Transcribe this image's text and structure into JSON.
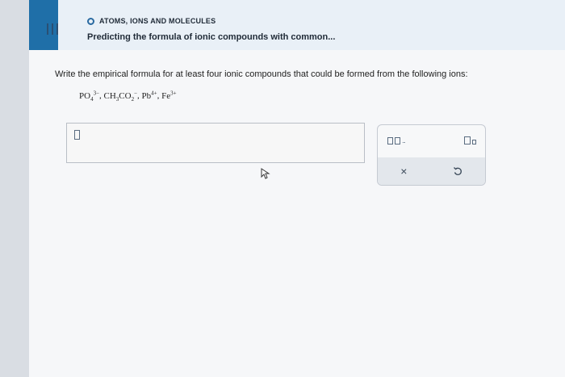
{
  "header": {
    "topic": "ATOMS, IONS AND MOLECULES",
    "lesson_title": "Predicting the formula of ionic compounds with common..."
  },
  "question": {
    "instructions": "Write the empirical formula for at least four ionic compounds that could be formed from the following ions:",
    "ions": [
      {
        "base": "PO",
        "sub": "4",
        "sup": "3−"
      },
      {
        "base": "CH",
        "sub": "3",
        "mid": "CO",
        "sub2": "2",
        "sup": "−"
      },
      {
        "base": "Pb",
        "sup": "4+"
      },
      {
        "base": "Fe",
        "sup": "3+"
      }
    ]
  },
  "answer": {
    "value": ""
  },
  "toolbar": {
    "multi_box_label": "□,□,...",
    "subscript_label": "□□",
    "clear_label": "×",
    "undo_label": "↺"
  },
  "icons": {
    "menu": "hamburger-menu-icon",
    "topic": "circle-icon",
    "expand": "chevron-down-icon",
    "clear": "close-icon",
    "undo": "undo-icon",
    "pointer": "mouse-cursor-icon"
  },
  "colors": {
    "accent": "#1f6fa8",
    "header_bg": "#e9f0f7",
    "text": "#1f2a37"
  }
}
